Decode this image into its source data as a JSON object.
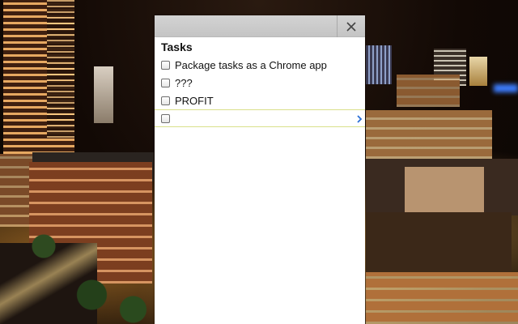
{
  "panel": {
    "list_title": "Tasks",
    "close_icon": "close-icon",
    "tasks": [
      {
        "text": "Package tasks as a Chrome app",
        "checked": false
      },
      {
        "text": "???",
        "checked": false
      },
      {
        "text": "PROFIT",
        "checked": false
      },
      {
        "text": "",
        "checked": false,
        "active": true
      }
    ],
    "details_icon": "chevron-right-icon",
    "accent_color": "#2a6fd6"
  }
}
